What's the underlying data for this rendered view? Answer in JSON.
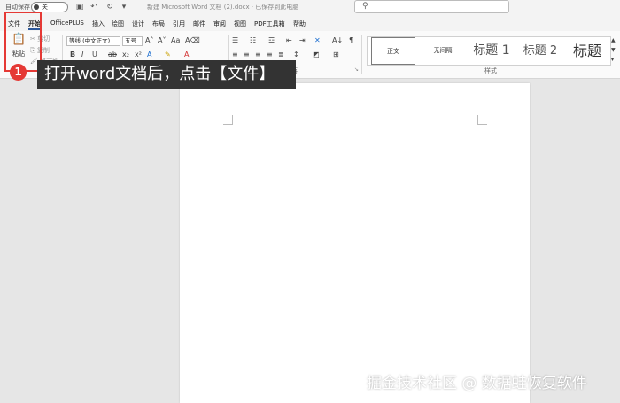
{
  "titlebar": {
    "autosave_label": "自动保存",
    "autosave_state": "关",
    "doc_title": "新建 Microsoft Word 文档 (2).docx · 已保存到此电脑",
    "search_placeholder": ""
  },
  "tabs": [
    "文件",
    "开始",
    "OfficePLUS",
    "插入",
    "绘图",
    "设计",
    "布局",
    "引用",
    "邮件",
    "审阅",
    "视图",
    "PDF工具箱",
    "帮助"
  ],
  "ribbon": {
    "paste_label": "粘贴",
    "cut_label": "剪切",
    "copy_label": "复制",
    "format_painter_label": "格式刷",
    "font_name": "等线 (中文正文)",
    "font_size": "五号",
    "styles_group_label": "样式",
    "paragraph_group_label": "段落",
    "styles": [
      "正文",
      "无间隔",
      "标题 1",
      "标题 2",
      "标题"
    ]
  },
  "annotation": {
    "step_number": "1",
    "instruction": "打开word文档后，点击【文件】"
  },
  "watermark": "掘金技术社区 @ 数据蛙恢复软件",
  "colors": {
    "accent_red": "#e53935",
    "banner_bg": "#333333"
  }
}
